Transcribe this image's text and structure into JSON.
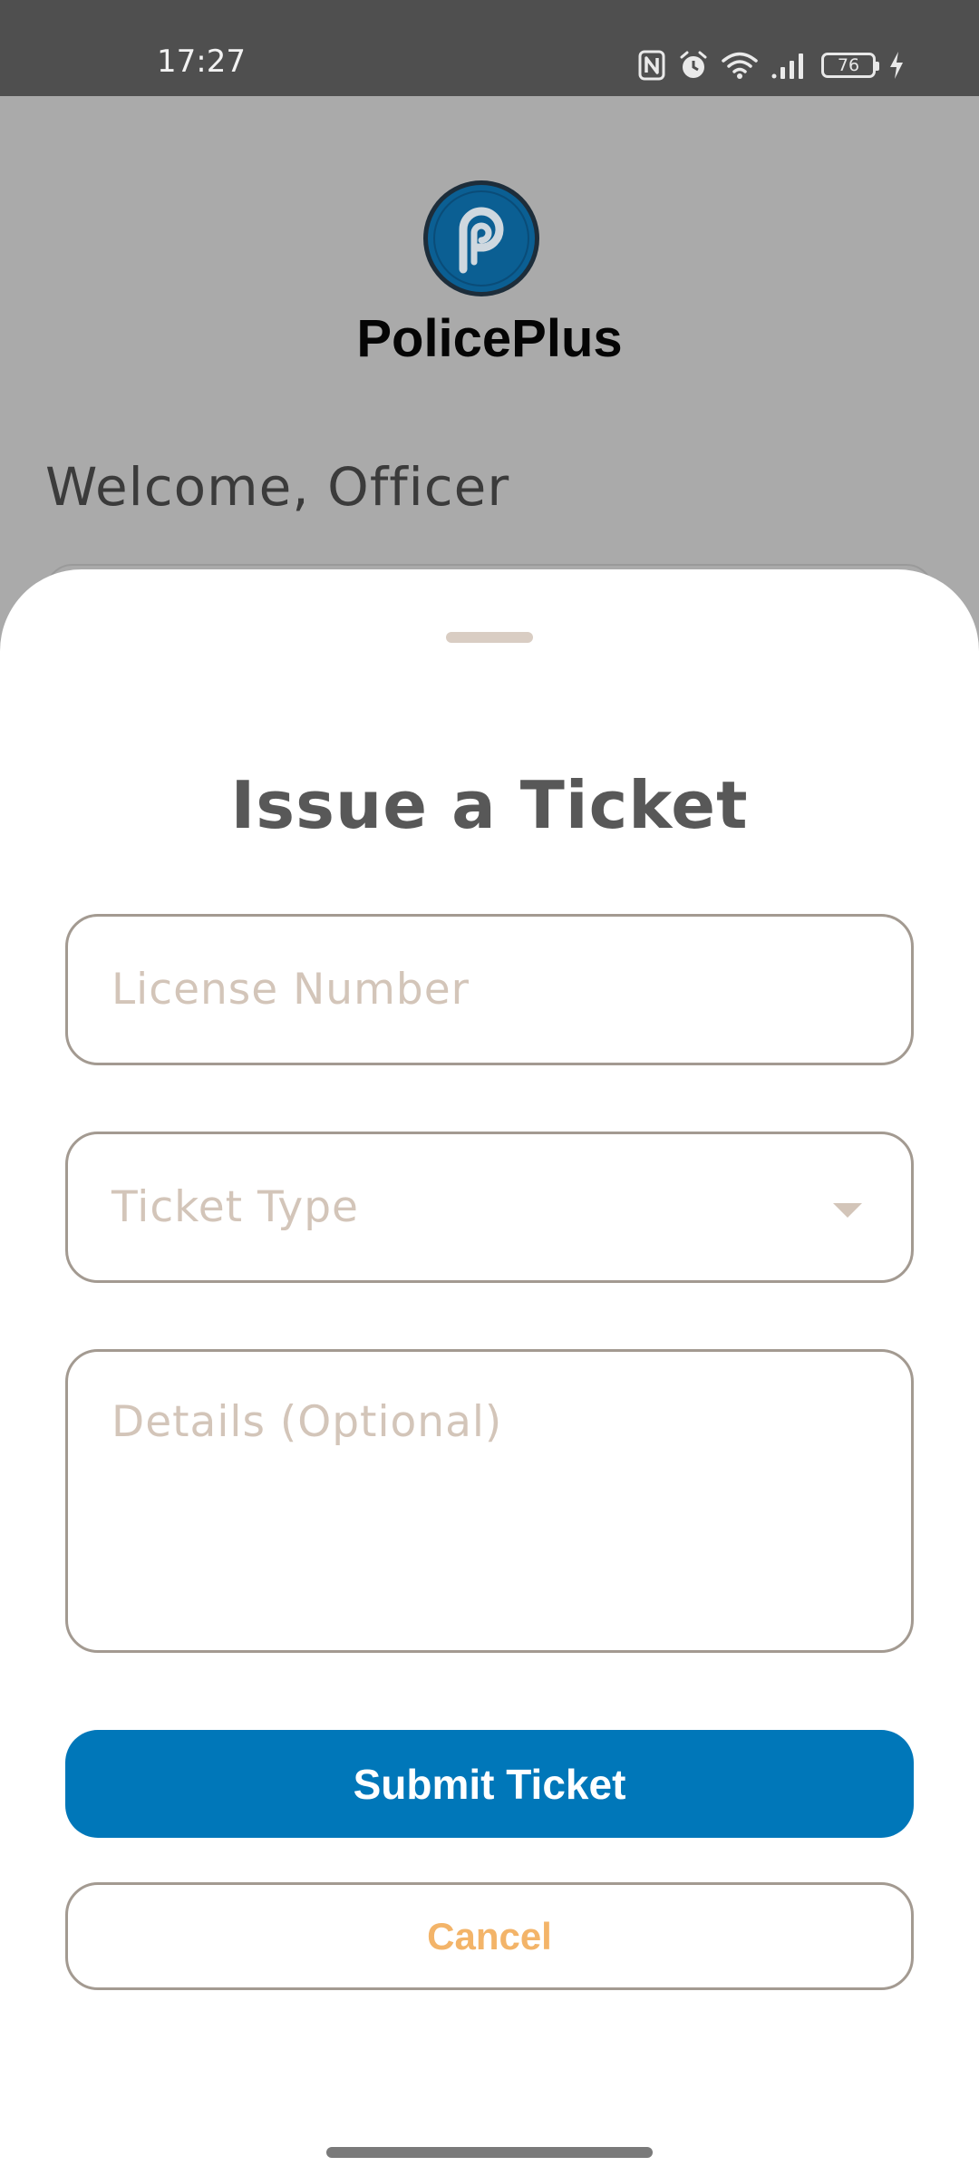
{
  "status_bar": {
    "time": "17:27",
    "battery_level": "76",
    "icons": [
      "nfc-icon",
      "alarm-icon",
      "wifi-icon",
      "signal-icon",
      "battery-icon",
      "charging-icon"
    ]
  },
  "background_page": {
    "app_name": "PolicePlus",
    "welcome_text": "Welcome, Officer",
    "logo_icon": "policeplus-logo",
    "logo_color": "#0b5f93"
  },
  "ticket_sheet": {
    "title": "Issue a Ticket",
    "license_placeholder": "License Number",
    "ticket_type_placeholder": "Ticket Type",
    "details_placeholder": "Details (Optional)",
    "submit_label": "Submit Ticket",
    "cancel_label": "Cancel"
  },
  "colors": {
    "primary": "#0077b9",
    "cancel_text": "#f3b469",
    "placeholder": "#d3c5b9",
    "border": "#a39a91",
    "scrim": "#aaaaaa"
  }
}
